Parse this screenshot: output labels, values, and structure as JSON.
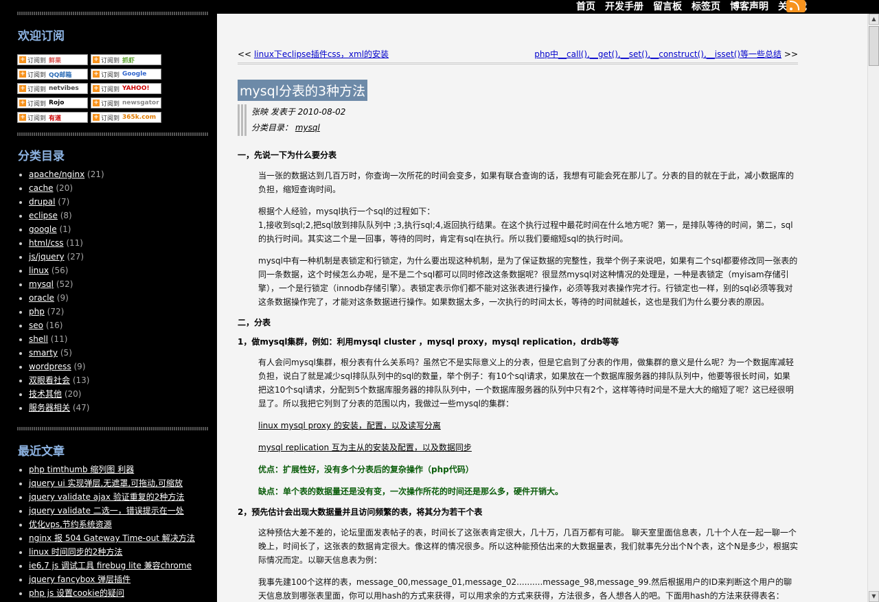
{
  "topnav": [
    "首页",
    "开发手册",
    "留言板",
    "标签页",
    "博客声明",
    "关于我"
  ],
  "sidebar": {
    "subscribe_title": "欢迎订阅",
    "feeds": [
      {
        "label": "订阅到",
        "brand": "鲜果"
      },
      {
        "label": "订阅到",
        "brand": "抓虾"
      },
      {
        "label": "订阅到",
        "brand": "QQ邮箱"
      },
      {
        "label": "订阅到",
        "brand": "Google"
      },
      {
        "label": "订阅到",
        "brand": "netvibes"
      },
      {
        "label": "订阅到",
        "brand": "YAHOO!"
      },
      {
        "label": "订阅到",
        "brand": "Rojo"
      },
      {
        "label": "订阅到",
        "brand": "newsgator"
      },
      {
        "label": "订阅到",
        "brand": "有道"
      },
      {
        "label": "订阅到",
        "brand": "365k.com"
      }
    ],
    "category_title": "分类目录",
    "categories": [
      {
        "name": "apache/nginx",
        "count": "(21)"
      },
      {
        "name": "cache",
        "count": "(20)"
      },
      {
        "name": "drupal",
        "count": "(7)"
      },
      {
        "name": "eclipse",
        "count": "(8)"
      },
      {
        "name": "google",
        "count": "(1)"
      },
      {
        "name": "html/css",
        "count": "(11)"
      },
      {
        "name": "js/jquery",
        "count": "(27)"
      },
      {
        "name": "linux",
        "count": "(56)"
      },
      {
        "name": "mysql",
        "count": "(52)"
      },
      {
        "name": "oracle",
        "count": "(9)"
      },
      {
        "name": "php",
        "count": "(72)"
      },
      {
        "name": "seo",
        "count": "(16)"
      },
      {
        "name": "shell",
        "count": "(11)"
      },
      {
        "name": "smarty",
        "count": "(5)"
      },
      {
        "name": "wordpress",
        "count": "(9)"
      },
      {
        "name": "双眼看社会",
        "count": "(13)"
      },
      {
        "name": "技术其他",
        "count": "(20)"
      },
      {
        "name": "服务器相关",
        "count": "(47)"
      }
    ],
    "recent_title": "最近文章",
    "recent": [
      "php timthumb 缩列图 利器",
      "jquery ui 实现弹层,无遮罩,可拖动,可缩放",
      "jquery validate ajax 验证重复的2种方法",
      "jquery validate 二选一，错误提示在一处",
      "优化vps,节约系统资源",
      "nginx 报 504 Gateway Time-out 解决方法",
      "linux 时间同步的2种方法",
      "ie6,7 js 调试工具 firebug lite 兼容chrome",
      "jquery fancybox 弹层插件",
      "php js 设置cookie的疑问"
    ]
  },
  "post": {
    "prev_arrow": "<<",
    "prev_link": "linux下eclipse插件css，xml的安装",
    "next_link": "php中__call(),__get(),__set(),__construct(),__isset()等一些总结",
    "next_arrow": ">>",
    "title": "mysql分表的3种方法",
    "author_line": "张映 发表于 2010-08-02",
    "category_label": "分类目录：",
    "category_link": "mysql",
    "h1": "一，先说一下为什么要分表",
    "p1": "当一张的数据达到几百万时，你查询一次所花的时间会变多，如果有联合查询的话，我想有可能会死在那儿了。分表的目的就在于此，减小数据库的负担，缩短查询时间。",
    "p2a": "根据个人经验，mysql执行一个sql的过程如下：",
    "p2b": "1,接收到sql;2,把sql放到排队队列中 ;3,执行sql;4,返回执行结果。在这个执行过程中最花时间在什么地方呢？第一，是排队等待的时间，第二，sql的执行时间。其实这二个是一回事，等待的同时，肯定有sql在执行。所以我们要缩短sql的执行时间。",
    "p3": "mysql中有一种机制是表锁定和行锁定，为什么要出现这种机制，是为了保证数据的完整性，我举个例子来说吧，如果有二个sql都要修改同一张表的同一条数据，这个时候怎么办呢，是不是二个sql都可以同时修改这条数据呢？很显然mysql对这种情况的处理是，一种是表锁定（myisam存储引擎），一个是行锁定（innodb存储引擎）。表锁定表示你们都不能对这张表进行操作，必须等我对表操作完才行。行锁定也一样，别的sql必须等我对这条数据操作完了，才能对这条数据进行操作。如果数据太多，一次执行的时间太长，等待的时间就越长，这也是我们为什么要分表的原因。",
    "h2": "二，分表",
    "h3": "1，做mysql集群，例如：利用mysql cluster ，mysql proxy，mysql replication，drdb等等",
    "p4": "有人会问mysql集群，根分表有什么关系吗？虽然它不是实际意义上的分表，但是它启到了分表的作用，做集群的意义是什么呢？为一个数据库减轻负担，说白了就是减少sql排队队列中的sql的数量，举个例子：有10个sql请求，如果放在一个数据库服务器的排队队列中，他要等很长时间，如果把这10个sql请求，分配到5个数据库服务器的排队队列中，一个数据库服务器的队列中只有2个，这样等待时间是不是大大的缩短了呢？这已经很明显了。所以我把它列到了分表的范围以内，我做过一些mysql的集群：",
    "link1": "linux mysql proxy 的安装，配置，以及读写分离",
    "link2": "mysql replication 互为主从的安装及配置，以及数据同步",
    "pro": "优点：扩展性好，没有多个分表后的复杂操作（php代码）",
    "con": "缺点：单个表的数据量还是没有变，一次操作所花的时间还是那么多，硬件开销大。",
    "h4": "2，预先估计会出现大数据量并且访问频繁的表，将其分为若干个表",
    "p5": "这种预估大差不差的，论坛里面发表帖子的表，时间长了这张表肯定很大，几十万，几百万都有可能。 聊天室里面信息表，几十个人在一起一聊一个晚上，时间长了，这张表的数据肯定很大。像这样的情况很多。所以这种能预估出来的大数据量表，我们就事先分出个N个表，这个N是多少，根据实际情况而定。以聊天信息表为例：",
    "p6": "我事先建100个这样的表，message_00,message_01,message_02..........message_98,message_99.然后根据用户的ID来判断这个用户的聊天信息放到哪张表里面，你可以用hash的方式来获得，可以用求余的方式来获得，方法很多，各人想各人的吧。下面用hash的方法来获得表名："
  },
  "colors": {
    "sidebar_bg": "#000000",
    "sidebar_heading": "#8db3e2",
    "title_bg": "#6d8aa8",
    "link": "#0000cc",
    "green": "#0a5c0a"
  }
}
